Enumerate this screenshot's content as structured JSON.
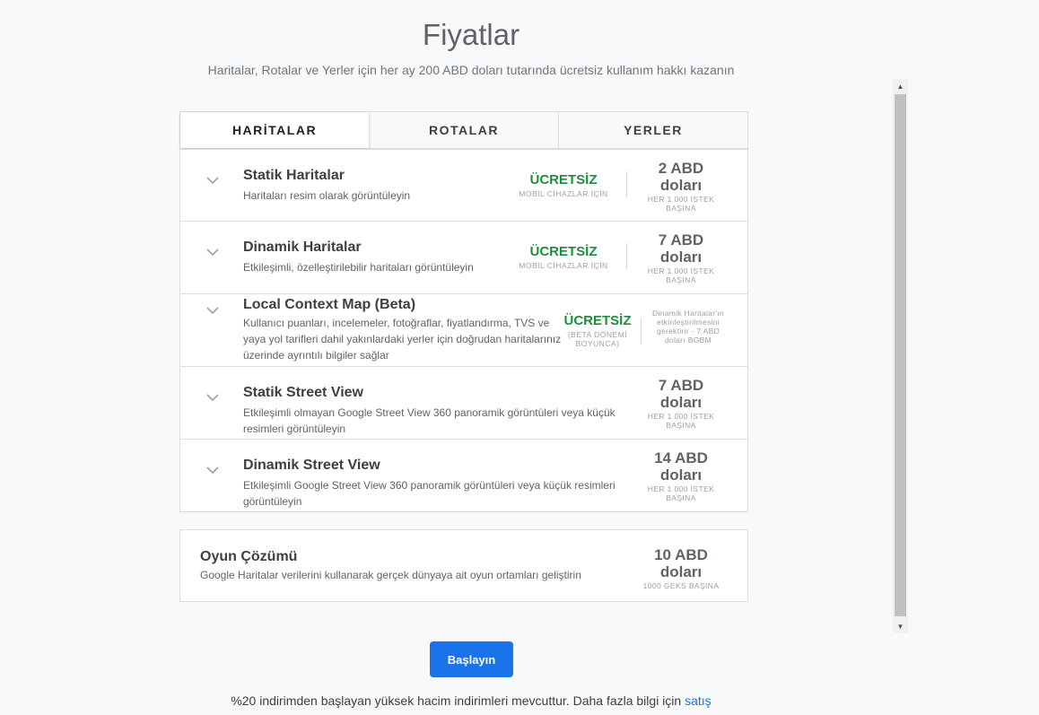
{
  "header": {
    "title": "Fiyatlar",
    "subtitle": "Haritalar, Rotalar ve Yerler için her ay 200 ABD doları tutarında ücretsiz kullanım hakkı kazanın"
  },
  "tabs": [
    {
      "label": "HARİTALAR",
      "active": true
    },
    {
      "label": "ROTALAR",
      "active": false
    },
    {
      "label": "YERLER",
      "active": false
    }
  ],
  "products": [
    {
      "name": "Statik Haritalar",
      "desc": "Haritaları resim olarak görüntüleyin",
      "free": "ÜCRETSİZ",
      "free_note": "MOBİL CİHAZLAR İÇİN",
      "price": "2 ABD doları",
      "per": "HER 1.000 İSTEK BAŞINA"
    },
    {
      "name": "Dinamik Haritalar",
      "desc": "Etkileşimli, özelleştirilebilir haritaları görüntüleyin",
      "free": "ÜCRETSİZ",
      "free_note": "MOBİL CİHAZLAR İÇİN",
      "price": "7 ABD doları",
      "per": "HER 1.000 İSTEK BAŞINA"
    },
    {
      "name": "Local Context Map (Beta)",
      "desc": "Kullanıcı puanları, incelemeler, fotoğraflar, fiyatlandırma, TVS ve yaya yol tarifleri dahil yakınlardaki yerler için doğrudan haritalarınız üzerinde ayrıntılı bilgiler sağlar",
      "free": "ÜCRETSİZ",
      "free_note": "(BETA DÖNEMİ BOYUNCA)",
      "note": "Dinamik Haritalar'ın etkinleştirilmesini gerektirir - 7 ABD doları BGBM"
    },
    {
      "name": "Statik Street View",
      "desc": "Etkileşimli olmayan Google Street View 360 panoramik görüntüleri veya küçük resimleri görüntüleyin",
      "price": "7 ABD doları",
      "per": "HER 1.000 İSTEK BAŞINA"
    },
    {
      "name": "Dinamik Street View",
      "desc": "Etkileşimli Google Street View 360 panoramik görüntüleri veya küçük resimleri görüntüleyin",
      "price": "14 ABD doları",
      "per": "HER 1.000 İSTEK BAŞINA"
    }
  ],
  "game": {
    "name": "Oyun Çözümü",
    "desc": "Google Haritalar verilerini kullanarak gerçek dünyaya ait oyun ortamları geliştirin",
    "price": "10 ABD doları",
    "per": "1000 GEKS BAŞINA"
  },
  "cta": {
    "label": "Başlayın"
  },
  "footer": {
    "text": "%20 indirimden başlayan yüksek hacim indirimleri mevcuttur. Daha fazla bilgi için ",
    "link": "satış"
  },
  "colors": {
    "accent": "#1a73e8",
    "free": "#1e8e3e"
  },
  "icons": {
    "expand": "chevron-down-icon"
  }
}
